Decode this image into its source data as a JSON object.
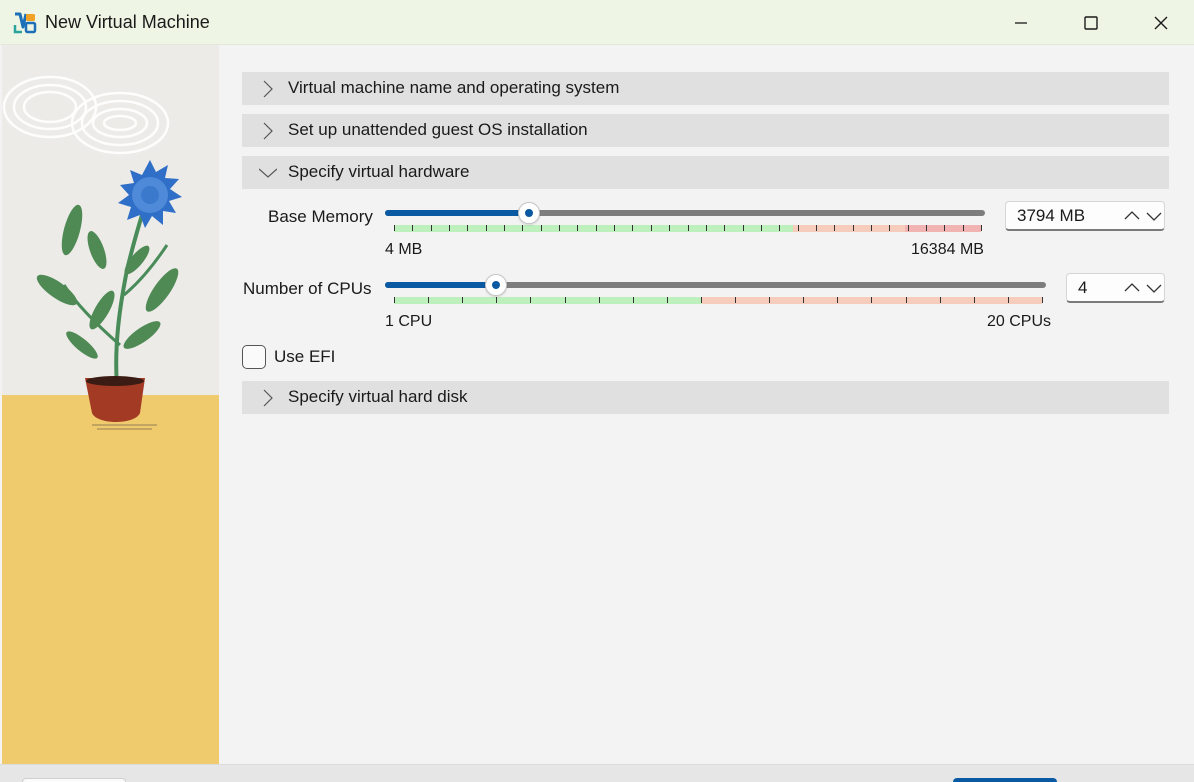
{
  "window": {
    "title": "New Virtual Machine",
    "app_icon": "virtualbox-logo-icon",
    "controls": [
      "minimize-icon",
      "maximize-icon",
      "close-icon"
    ]
  },
  "sections": [
    {
      "label": "Virtual machine name and operating system",
      "expanded": false
    },
    {
      "label": "Set up unattended guest OS installation",
      "expanded": false
    },
    {
      "label": "Specify virtual hardware",
      "expanded": true
    },
    {
      "label": "Specify virtual hard disk",
      "expanded": false
    }
  ],
  "hardware": {
    "memory": {
      "label": "Base Memory",
      "min_label": "4 MB",
      "max_label": "16384 MB",
      "value": "3794 MB",
      "min": 4,
      "max": 16384,
      "current": 3794
    },
    "cpus": {
      "label": "Number of CPUs",
      "min_label": "1 CPU",
      "max_label": "20 CPUs",
      "value": "4",
      "min": 1,
      "max": 20,
      "current": 4
    },
    "efi": {
      "label": "Use EFI",
      "checked": false
    }
  },
  "colors": {
    "accent": "#0a5aa3",
    "zone_ok": "#bdf0bd",
    "zone_warn": "#f6cdbc",
    "zone_bad": "#f2b3b3"
  }
}
